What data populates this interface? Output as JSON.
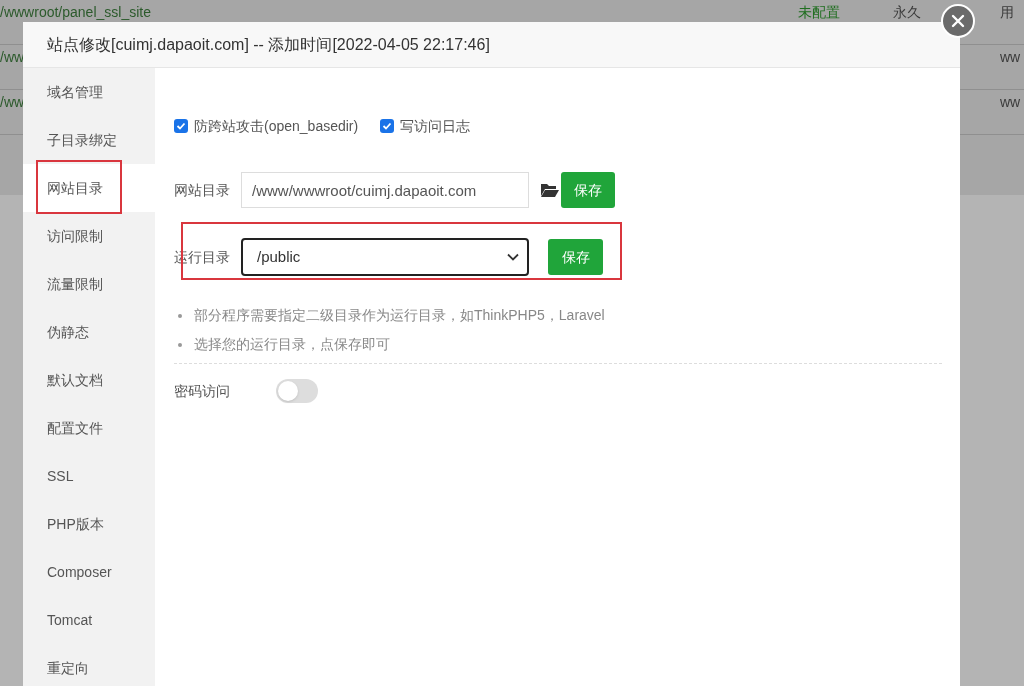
{
  "background_table": {
    "rows": [
      {
        "path": "/wwwroot/panel_ssl_site",
        "cells": [
          {
            "text": "未配置",
            "kind": "status"
          },
          {
            "text": "永久",
            "kind": "expiry"
          },
          {
            "text": "用",
            "kind": "note"
          }
        ]
      },
      {
        "path": "/ww",
        "cells": [
          {
            "text": "ww",
            "kind": "note"
          }
        ]
      },
      {
        "path": "/ww",
        "cells": [
          {
            "text": "ww",
            "kind": "note"
          }
        ]
      }
    ]
  },
  "dialog": {
    "title": "站点修改[cuimj.dapaoit.com] -- 添加时间[2022-04-05 22:17:46]",
    "sidebar": {
      "items": [
        {
          "label": "域名管理",
          "selected": false,
          "highlighted": false
        },
        {
          "label": "子目录绑定",
          "selected": false,
          "highlighted": false
        },
        {
          "label": "网站目录",
          "selected": true,
          "highlighted": true
        },
        {
          "label": "访问限制",
          "selected": false,
          "highlighted": false
        },
        {
          "label": "流量限制",
          "selected": false,
          "highlighted": false
        },
        {
          "label": "伪静态",
          "selected": false,
          "highlighted": false
        },
        {
          "label": "默认文档",
          "selected": false,
          "highlighted": false
        },
        {
          "label": "配置文件",
          "selected": false,
          "highlighted": false
        },
        {
          "label": "SSL",
          "selected": false,
          "highlighted": false
        },
        {
          "label": "PHP版本",
          "selected": false,
          "highlighted": false
        },
        {
          "label": "Composer",
          "selected": false,
          "highlighted": false
        },
        {
          "label": "Tomcat",
          "selected": false,
          "highlighted": false
        },
        {
          "label": "重定向",
          "selected": false,
          "highlighted": false
        }
      ]
    },
    "checkboxes": [
      {
        "label": "防跨站攻击(open_basedir)",
        "checked": true
      },
      {
        "label": "写访问日志",
        "checked": true
      }
    ],
    "site_dir": {
      "label": "网站目录",
      "value": "/www/wwwroot/cuimj.dapaoit.com",
      "button": "保存"
    },
    "run_dir": {
      "label": "运行目录",
      "value": "/public",
      "button": "保存",
      "highlighted": true
    },
    "tips": [
      "部分程序需要指定二级目录作为运行目录，如ThinkPHP5，Laravel",
      "选择您的运行目录，点保存即可"
    ],
    "password_access": {
      "label": "密码访问",
      "on": false
    }
  }
}
